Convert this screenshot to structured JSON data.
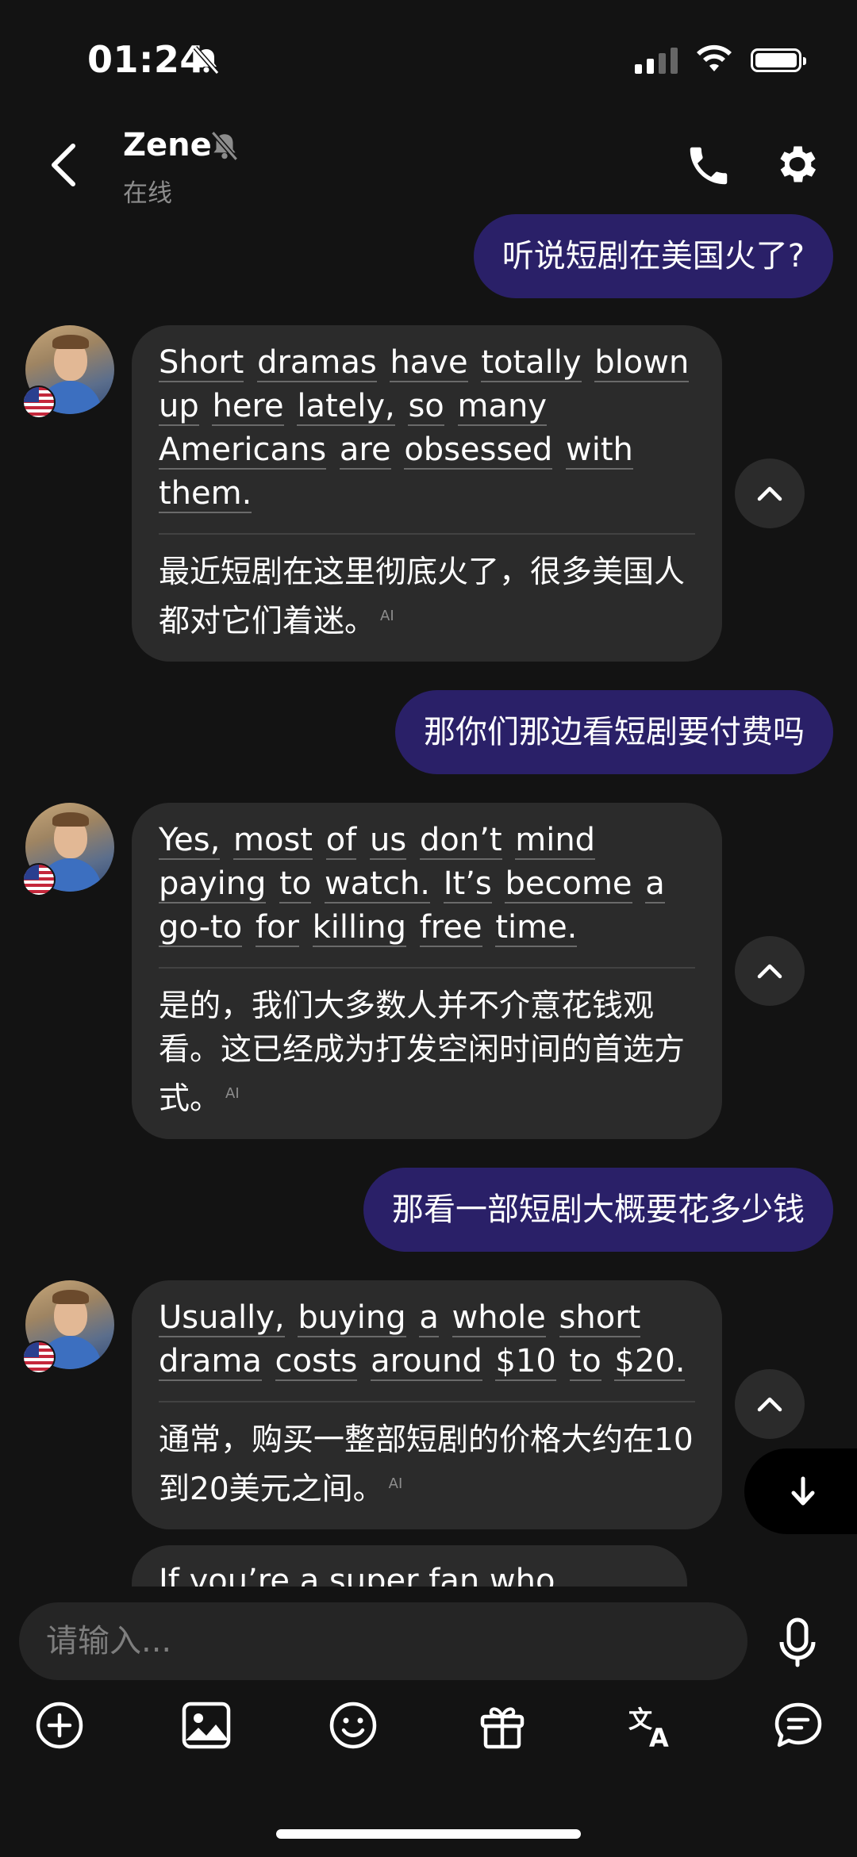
{
  "status_bar": {
    "time": "01:24"
  },
  "header": {
    "name": "Zene",
    "status": "在线"
  },
  "messages": [
    {
      "role": "out",
      "text": "听说短剧在美国火了?"
    },
    {
      "role": "in",
      "en_words": [
        "Short",
        "dramas",
        "have",
        "totally",
        "blown",
        "up",
        "here",
        "lately,",
        "so",
        "many",
        "Americans",
        "are",
        "obsessed",
        "with",
        "them."
      ],
      "zh": "最近短剧在这里彻底火了，很多美国人都对它们着迷。"
    },
    {
      "role": "out",
      "text": "那你们那边看短剧要付费吗"
    },
    {
      "role": "in",
      "en_words": [
        "Yes,",
        "most",
        "of",
        "us",
        "don’t",
        "mind",
        "paying",
        "to",
        "watch.",
        "It’s",
        "become",
        "a",
        "go-to",
        "for",
        "killing",
        "free",
        "time."
      ],
      "zh": "是的，我们大多数人并不介意花钱观看。这已经成为打发空闲时间的首选方式。"
    },
    {
      "role": "out",
      "text": "那看一部短剧大概要花多少钱"
    },
    {
      "role": "in",
      "en_words": [
        "Usually,",
        "buying",
        "a",
        "whole",
        "short",
        "drama",
        "costs",
        "around",
        "$10",
        "to",
        "$20."
      ],
      "zh": "通常，购买一整部短剧的价格大约在10到20美元之间。"
    }
  ],
  "ai_badge": "AI",
  "partial_message": "If you’re a super fan who",
  "composer": {
    "placeholder": "请输入..."
  },
  "toolbar_icons": [
    "plus-circle-icon",
    "image-icon",
    "emoji-icon",
    "gift-icon",
    "translate-icon",
    "chat-icon"
  ]
}
